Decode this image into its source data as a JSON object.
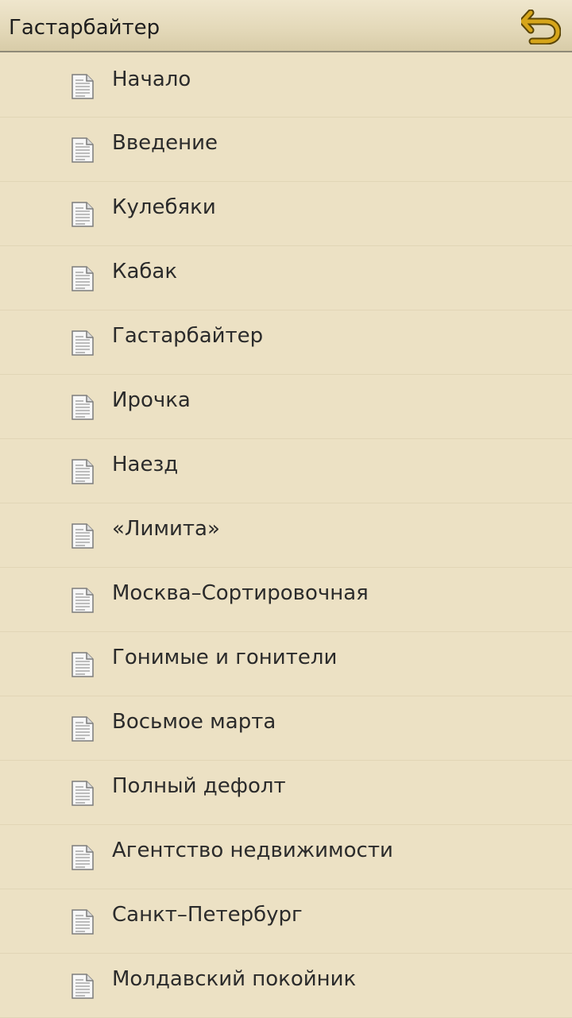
{
  "header": {
    "title": "Гастарбайтер",
    "back_icon": "back-arrow-icon"
  },
  "colors": {
    "background": "#ece1c4",
    "header_background": "#e3d8b8",
    "accent": "#c79a12"
  },
  "toc": {
    "item_icon": "document-icon",
    "items": [
      {
        "label": "Начало"
      },
      {
        "label": "Введение"
      },
      {
        "label": "Кулебяки"
      },
      {
        "label": "Кабак"
      },
      {
        "label": "Гастарбайтер"
      },
      {
        "label": "Ирочка"
      },
      {
        "label": "Наезд"
      },
      {
        "label": "«Лимита»"
      },
      {
        "label": "Москва–Сортировочная"
      },
      {
        "label": "Гонимые и гонители"
      },
      {
        "label": "Восьмое марта"
      },
      {
        "label": "Полный дефолт"
      },
      {
        "label": "Агентство недвижимости"
      },
      {
        "label": "Санкт–Петербург"
      },
      {
        "label": "Молдавский покойник"
      }
    ]
  }
}
